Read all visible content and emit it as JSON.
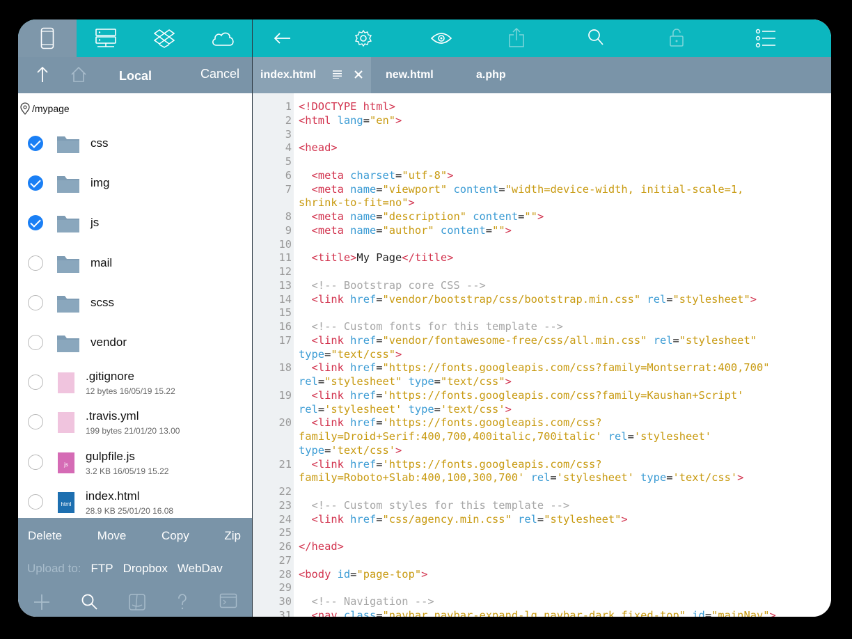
{
  "source_tabs": [
    {
      "name": "device",
      "icon": "phone-icon",
      "active": true
    },
    {
      "name": "server",
      "icon": "server-icon",
      "active": false
    },
    {
      "name": "dropbox",
      "icon": "dropbox-icon",
      "active": false
    },
    {
      "name": "cloud",
      "icon": "cloud-icon",
      "active": false
    }
  ],
  "left_nav": {
    "title": "Local",
    "cancel": "Cancel"
  },
  "path": "/mypage",
  "files": [
    {
      "name": "css",
      "type": "folder",
      "checked": true
    },
    {
      "name": "img",
      "type": "folder",
      "checked": true
    },
    {
      "name": "js",
      "type": "folder",
      "checked": true
    },
    {
      "name": "mail",
      "type": "folder",
      "checked": false
    },
    {
      "name": "scss",
      "type": "folder",
      "checked": false
    },
    {
      "name": "vendor",
      "type": "folder",
      "checked": false
    },
    {
      "name": ".gitignore",
      "type": "file",
      "meta": "12 bytes 16/05/19 15.22",
      "checked": false,
      "badge": ""
    },
    {
      "name": ".travis.yml",
      "type": "file",
      "meta": "199 bytes 21/01/20 13.00",
      "checked": false,
      "badge": ""
    },
    {
      "name": "gulpfile.js",
      "type": "file-js",
      "meta": "3.2 KB 16/05/19 15.22",
      "checked": false,
      "badge": "js"
    },
    {
      "name": "index.html",
      "type": "file-html",
      "meta": "28.9 KB 25/01/20 16.08",
      "checked": false,
      "badge": "html"
    }
  ],
  "actions": {
    "delete": "Delete",
    "move": "Move",
    "copy": "Copy",
    "zip": "Zip"
  },
  "upload": {
    "label": "Upload to:",
    "ftp": "FTP",
    "dropbox": "Dropbox",
    "webdav": "WebDav"
  },
  "tabs": [
    {
      "label": "index.html",
      "active": true
    },
    {
      "label": "new.html",
      "active": false
    },
    {
      "label": "a.php",
      "active": false
    }
  ],
  "colors": {
    "toolbar": "#0cb7bf",
    "panel": "#7a94a8",
    "check": "#1a7ff5",
    "tag": "#d2334e",
    "attr": "#3a9bd4",
    "string": "#c89a10",
    "comment": "#a6a6a6"
  },
  "code_lines": [
    {
      "n": "1",
      "segs": [
        [
          "t",
          "<!DOCTYPE html>"
        ]
      ]
    },
    {
      "n": "2",
      "segs": [
        [
          "t",
          "<html "
        ],
        [
          "a",
          "lang"
        ],
        [
          "p",
          "="
        ],
        [
          "s",
          "\"en\""
        ],
        [
          "t",
          ">"
        ]
      ]
    },
    {
      "n": "3",
      "segs": []
    },
    {
      "n": "4",
      "segs": [
        [
          "t",
          "<head>"
        ]
      ]
    },
    {
      "n": "5",
      "segs": []
    },
    {
      "n": "6",
      "segs": [
        [
          "p",
          "  "
        ],
        [
          "t",
          "<meta "
        ],
        [
          "a",
          "charset"
        ],
        [
          "p",
          "="
        ],
        [
          "s",
          "\"utf-8\""
        ],
        [
          "t",
          ">"
        ]
      ]
    },
    {
      "n": "7",
      "segs": [
        [
          "p",
          "  "
        ],
        [
          "t",
          "<meta "
        ],
        [
          "a",
          "name"
        ],
        [
          "p",
          "="
        ],
        [
          "s",
          "\"viewport\" "
        ],
        [
          "a",
          "content"
        ],
        [
          "p",
          "="
        ],
        [
          "s",
          "\"width=device-width, initial-scale=1,"
        ]
      ]
    },
    {
      "n": "",
      "segs": [
        [
          "s",
          "shrink-to-fit=no\""
        ],
        [
          "t",
          ">"
        ]
      ]
    },
    {
      "n": "8",
      "segs": [
        [
          "p",
          "  "
        ],
        [
          "t",
          "<meta "
        ],
        [
          "a",
          "name"
        ],
        [
          "p",
          "="
        ],
        [
          "s",
          "\"description\" "
        ],
        [
          "a",
          "content"
        ],
        [
          "p",
          "="
        ],
        [
          "s",
          "\"\""
        ],
        [
          "t",
          ">"
        ]
      ]
    },
    {
      "n": "9",
      "segs": [
        [
          "p",
          "  "
        ],
        [
          "t",
          "<meta "
        ],
        [
          "a",
          "name"
        ],
        [
          "p",
          "="
        ],
        [
          "s",
          "\"author\" "
        ],
        [
          "a",
          "content"
        ],
        [
          "p",
          "="
        ],
        [
          "s",
          "\"\""
        ],
        [
          "t",
          ">"
        ]
      ]
    },
    {
      "n": "10",
      "segs": []
    },
    {
      "n": "11",
      "segs": [
        [
          "p",
          "  "
        ],
        [
          "t",
          "<title>"
        ],
        [
          "p",
          "My Page"
        ],
        [
          "t",
          "</title>"
        ]
      ]
    },
    {
      "n": "12",
      "segs": []
    },
    {
      "n": "13",
      "segs": [
        [
          "p",
          "  "
        ],
        [
          "c",
          "<!-- Bootstrap core CSS -->"
        ]
      ]
    },
    {
      "n": "14",
      "segs": [
        [
          "p",
          "  "
        ],
        [
          "t",
          "<link "
        ],
        [
          "a",
          "href"
        ],
        [
          "p",
          "="
        ],
        [
          "s",
          "\"vendor/bootstrap/css/bootstrap.min.css\" "
        ],
        [
          "a",
          "rel"
        ],
        [
          "p",
          "="
        ],
        [
          "s",
          "\"stylesheet\""
        ],
        [
          "t",
          ">"
        ]
      ]
    },
    {
      "n": "15",
      "segs": []
    },
    {
      "n": "16",
      "segs": [
        [
          "p",
          "  "
        ],
        [
          "c",
          "<!-- Custom fonts for this template -->"
        ]
      ]
    },
    {
      "n": "17",
      "segs": [
        [
          "p",
          "  "
        ],
        [
          "t",
          "<link "
        ],
        [
          "a",
          "href"
        ],
        [
          "p",
          "="
        ],
        [
          "s",
          "\"vendor/fontawesome-free/css/all.min.css\" "
        ],
        [
          "a",
          "rel"
        ],
        [
          "p",
          "="
        ],
        [
          "s",
          "\"stylesheet\""
        ]
      ]
    },
    {
      "n": "",
      "segs": [
        [
          "a",
          "type"
        ],
        [
          "p",
          "="
        ],
        [
          "s",
          "\"text/css\""
        ],
        [
          "t",
          ">"
        ]
      ]
    },
    {
      "n": "18",
      "segs": [
        [
          "p",
          "  "
        ],
        [
          "t",
          "<link "
        ],
        [
          "a",
          "href"
        ],
        [
          "p",
          "="
        ],
        [
          "s",
          "\"https://fonts.googleapis.com/css?family=Montserrat:400,700\""
        ]
      ]
    },
    {
      "n": "",
      "segs": [
        [
          "a",
          "rel"
        ],
        [
          "p",
          "="
        ],
        [
          "s",
          "\"stylesheet\" "
        ],
        [
          "a",
          "type"
        ],
        [
          "p",
          "="
        ],
        [
          "s",
          "\"text/css\""
        ],
        [
          "t",
          ">"
        ]
      ]
    },
    {
      "n": "19",
      "segs": [
        [
          "p",
          "  "
        ],
        [
          "t",
          "<link "
        ],
        [
          "a",
          "href"
        ],
        [
          "p",
          "="
        ],
        [
          "s",
          "'https://fonts.googleapis.com/css?family=Kaushan+Script'"
        ]
      ]
    },
    {
      "n": "",
      "segs": [
        [
          "a",
          "rel"
        ],
        [
          "p",
          "="
        ],
        [
          "s",
          "'stylesheet' "
        ],
        [
          "a",
          "type"
        ],
        [
          "p",
          "="
        ],
        [
          "s",
          "'text/css'"
        ],
        [
          "t",
          ">"
        ]
      ]
    },
    {
      "n": "20",
      "segs": [
        [
          "p",
          "  "
        ],
        [
          "t",
          "<link "
        ],
        [
          "a",
          "href"
        ],
        [
          "p",
          "="
        ],
        [
          "s",
          "'https://fonts.googleapis.com/css?"
        ]
      ]
    },
    {
      "n": "",
      "segs": [
        [
          "s",
          "family=Droid+Serif:400,700,400italic,700italic' "
        ],
        [
          "a",
          "rel"
        ],
        [
          "p",
          "="
        ],
        [
          "s",
          "'stylesheet'"
        ]
      ]
    },
    {
      "n": "",
      "segs": [
        [
          "a",
          "type"
        ],
        [
          "p",
          "="
        ],
        [
          "s",
          "'text/css'"
        ],
        [
          "t",
          ">"
        ]
      ]
    },
    {
      "n": "21",
      "segs": [
        [
          "p",
          "  "
        ],
        [
          "t",
          "<link "
        ],
        [
          "a",
          "href"
        ],
        [
          "p",
          "="
        ],
        [
          "s",
          "'https://fonts.googleapis.com/css?"
        ]
      ]
    },
    {
      "n": "",
      "segs": [
        [
          "s",
          "family=Roboto+Slab:400,100,300,700' "
        ],
        [
          "a",
          "rel"
        ],
        [
          "p",
          "="
        ],
        [
          "s",
          "'stylesheet' "
        ],
        [
          "a",
          "type"
        ],
        [
          "p",
          "="
        ],
        [
          "s",
          "'text/css'"
        ],
        [
          "t",
          ">"
        ]
      ]
    },
    {
      "n": "22",
      "segs": []
    },
    {
      "n": "23",
      "segs": [
        [
          "p",
          "  "
        ],
        [
          "c",
          "<!-- Custom styles for this template -->"
        ]
      ]
    },
    {
      "n": "24",
      "segs": [
        [
          "p",
          "  "
        ],
        [
          "t",
          "<link "
        ],
        [
          "a",
          "href"
        ],
        [
          "p",
          "="
        ],
        [
          "s",
          "\"css/agency.min.css\" "
        ],
        [
          "a",
          "rel"
        ],
        [
          "p",
          "="
        ],
        [
          "s",
          "\"stylesheet\""
        ],
        [
          "t",
          ">"
        ]
      ]
    },
    {
      "n": "25",
      "segs": []
    },
    {
      "n": "26",
      "segs": [
        [
          "t",
          "</head>"
        ]
      ]
    },
    {
      "n": "27",
      "segs": []
    },
    {
      "n": "28",
      "segs": [
        [
          "t",
          "<body "
        ],
        [
          "a",
          "id"
        ],
        [
          "p",
          "="
        ],
        [
          "s",
          "\"page-top\""
        ],
        [
          "t",
          ">"
        ]
      ]
    },
    {
      "n": "29",
      "segs": []
    },
    {
      "n": "30",
      "segs": [
        [
          "p",
          "  "
        ],
        [
          "c",
          "<!-- Navigation -->"
        ]
      ]
    },
    {
      "n": "31",
      "segs": [
        [
          "p",
          "  "
        ],
        [
          "t",
          "<nav "
        ],
        [
          "a",
          "class"
        ],
        [
          "p",
          "="
        ],
        [
          "s",
          "\"navbar navbar-expand-lg navbar-dark fixed-top\" "
        ],
        [
          "a",
          "id"
        ],
        [
          "p",
          "="
        ],
        [
          "s",
          "\"mainNav\""
        ],
        [
          "t",
          ">"
        ]
      ]
    }
  ]
}
